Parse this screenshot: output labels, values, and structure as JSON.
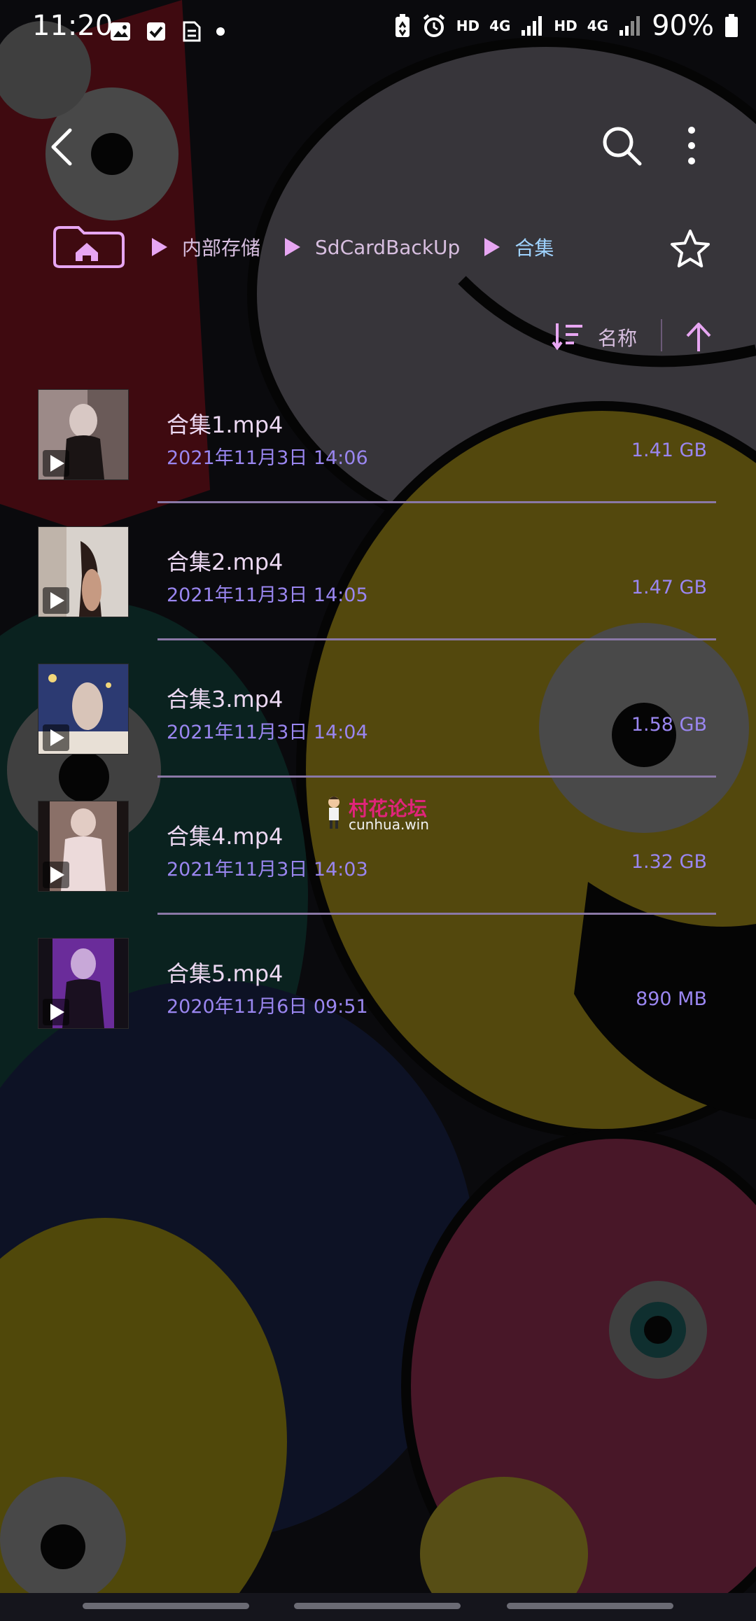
{
  "status_bar": {
    "time": "11:20",
    "left_icons": [
      "image-icon",
      "checkbox-icon",
      "document-icon",
      "dot-icon"
    ],
    "right_icons": [
      "battery-saver-icon",
      "alarm-icon",
      "signal-icon"
    ],
    "hd1": "HD",
    "net1": "4G",
    "hd2": "HD",
    "net2": "4G",
    "battery_percent": "90%"
  },
  "app_bar": {
    "back_icon": "back-arrow-icon",
    "search_icon": "search-icon",
    "more_icon": "more-vert-icon"
  },
  "breadcrumb": {
    "home_icon": "home-folder-icon",
    "items": [
      {
        "label": "内部存储"
      },
      {
        "label": "SdCardBackUp"
      },
      {
        "label": "合集"
      }
    ],
    "favorite_icon": "star-icon"
  },
  "sort": {
    "icon": "sort-icon",
    "label": "名称",
    "direction_icon": "arrow-up-icon"
  },
  "files": [
    {
      "name": "合集1.mp4",
      "date": "2021年11月3日 14:06",
      "size": "1.41 GB"
    },
    {
      "name": "合集2.mp4",
      "date": "2021年11月3日 14:05",
      "size": "1.47 GB"
    },
    {
      "name": "合集3.mp4",
      "date": "2021年11月3日 14:04",
      "size": "1.58 GB"
    },
    {
      "name": "合集4.mp4",
      "date": "2021年11月3日 14:03",
      "size": "1.32 GB"
    },
    {
      "name": "合集5.mp4",
      "date": "2020年11月6日 09:51",
      "size": "890 MB"
    }
  ],
  "watermark": {
    "title": "村花论坛",
    "url": "cunhua.win"
  },
  "colors": {
    "primary_text": "#ecd8f2",
    "secondary_text": "#9a86f0",
    "accent_pink": "#e7a6f2",
    "active_crumb": "#9fd3ff",
    "divider": "#8a78a6"
  }
}
